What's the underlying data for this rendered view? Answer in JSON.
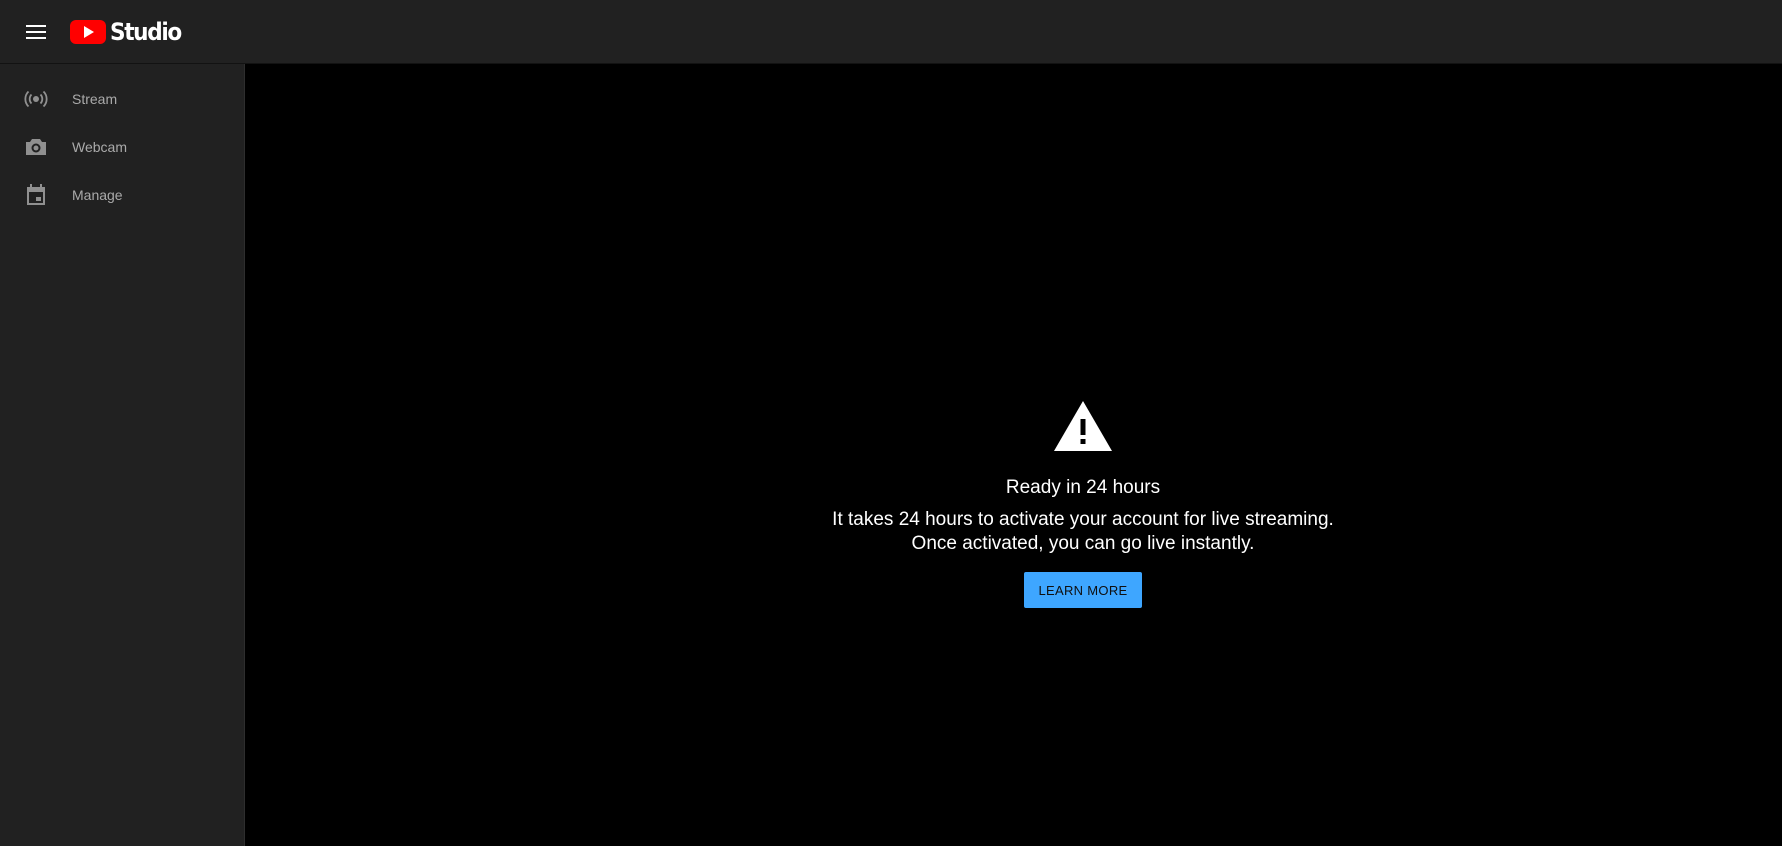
{
  "header": {
    "logo_text": "Studio",
    "menu_icon": "hamburger-menu-icon",
    "logo_icon": "youtube-play-icon",
    "brand_color": "#ff0000"
  },
  "sidebar": {
    "items": [
      {
        "label": "Stream",
        "icon": "broadcast-icon"
      },
      {
        "label": "Webcam",
        "icon": "camera-icon"
      },
      {
        "label": "Manage",
        "icon": "calendar-icon"
      }
    ]
  },
  "notice": {
    "icon": "warning-icon",
    "title": "Ready in 24 hours",
    "body": "It takes 24 hours to activate your account for live streaming. Once activated, you can go live instantly.",
    "button_label": "LEARN MORE",
    "button_color": "#3ea6ff"
  }
}
